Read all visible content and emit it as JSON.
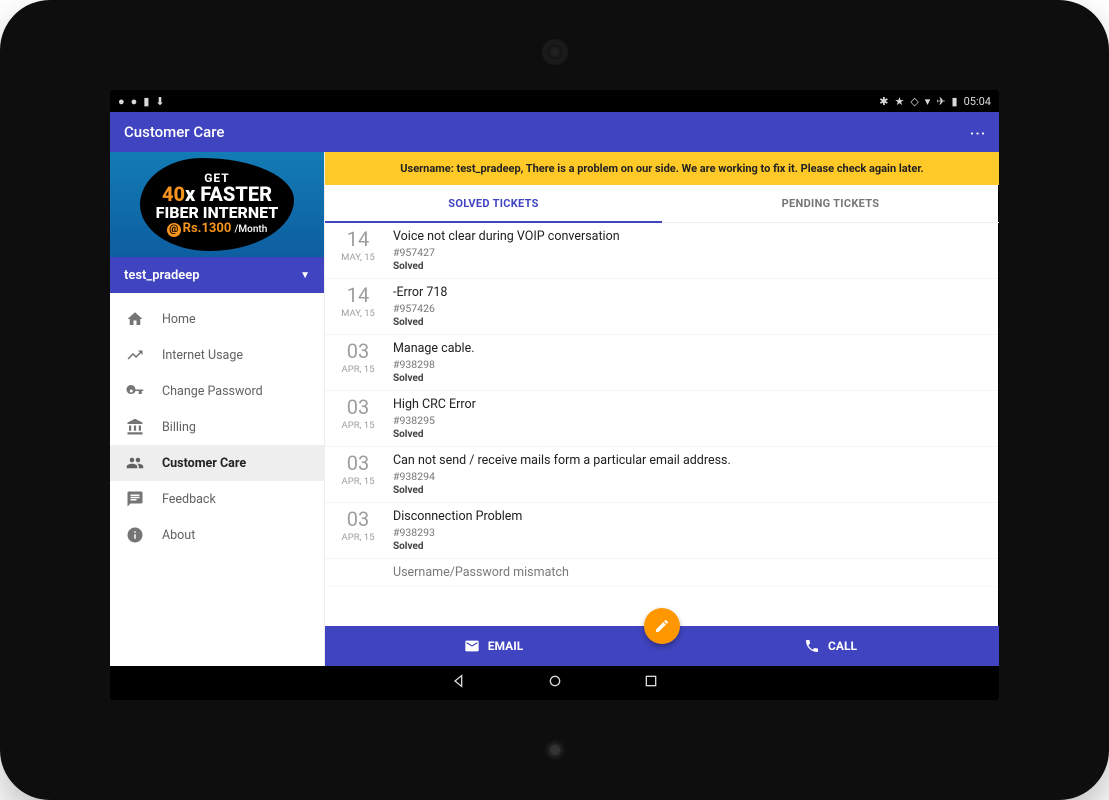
{
  "statusbar": {
    "time": "05:04"
  },
  "appbar": {
    "title": "Customer Care"
  },
  "promo": {
    "line1": "GET",
    "forty": "40",
    "x": "x",
    "faster": "FASTER",
    "fiber": "FIBER INTERNET",
    "price": "Rs.1300",
    "month": "/Month"
  },
  "user": {
    "name": "test_pradeep"
  },
  "nav": {
    "items": [
      {
        "label": "Home"
      },
      {
        "label": "Internet Usage"
      },
      {
        "label": "Change Password"
      },
      {
        "label": "Billing"
      },
      {
        "label": "Customer Care"
      },
      {
        "label": "Feedback"
      },
      {
        "label": "About"
      }
    ]
  },
  "alert": {
    "text": "Username: test_pradeep, There is a problem on our side. We are working to fix it.  Please check again later."
  },
  "tabs": {
    "solved": "SOLVED TICKETS",
    "pending": "PENDING TICKETS"
  },
  "tickets": [
    {
      "day": "14",
      "mon": "MAY, 15",
      "title": "Voice not clear during VOIP conversation",
      "id": "#957427",
      "status": "Solved"
    },
    {
      "day": "14",
      "mon": "MAY, 15",
      "title": "-Error 718",
      "id": "#957426",
      "status": "Solved"
    },
    {
      "day": "03",
      "mon": "APR, 15",
      "title": "Manage cable.",
      "id": "#938298",
      "status": "Solved"
    },
    {
      "day": "03",
      "mon": "APR, 15",
      "title": "High CRC Error",
      "id": "#938295",
      "status": "Solved"
    },
    {
      "day": "03",
      "mon": "APR, 15",
      "title": "Can not send / receive mails form a particular email address.",
      "id": "#938294",
      "status": "Solved"
    },
    {
      "day": "03",
      "mon": "APR, 15",
      "title": "Disconnection Problem",
      "id": "#938293",
      "status": "Solved"
    }
  ],
  "ticket_partial": {
    "title": "Username/Password mismatch"
  },
  "actions": {
    "email": "EMAIL",
    "call": "CALL"
  }
}
